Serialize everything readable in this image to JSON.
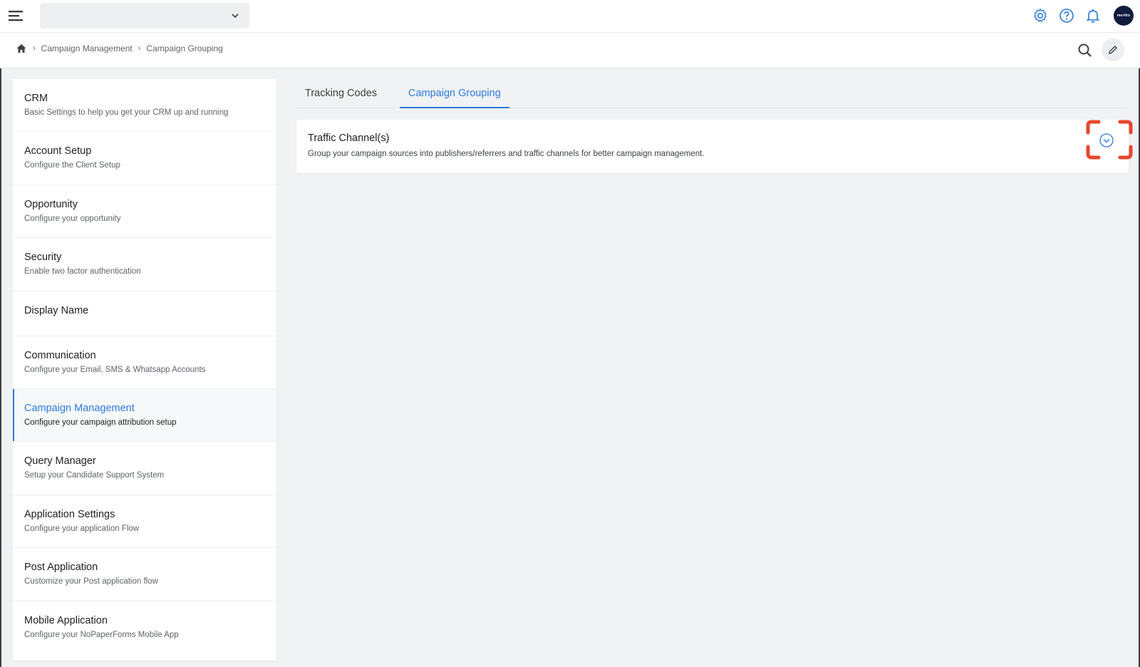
{
  "header": {
    "client_select_value": "",
    "icons": [
      "menu-icon",
      "chevron-down-icon",
      "gear-icon",
      "help-icon",
      "bell-icon"
    ],
    "avatar_text": "meritto",
    "accent_color": "#2e7bdc"
  },
  "breadcrumb": {
    "items": [
      "Campaign Management",
      "Campaign Grouping"
    ]
  },
  "sidebar": {
    "items": [
      {
        "title": "CRM",
        "desc": "Basic Settings to help you get your CRM up and running"
      },
      {
        "title": "Account Setup",
        "desc": "Configure the Client Setup"
      },
      {
        "title": "Opportunity",
        "desc": "Configure your opportunity"
      },
      {
        "title": "Security",
        "desc": "Enable two factor authentication"
      },
      {
        "title": "Display Name",
        "desc": ""
      },
      {
        "title": "Communication",
        "desc": "Configure your Email, SMS & Whatsapp Accounts"
      },
      {
        "title": "Campaign Management",
        "desc": "Configure your campaign attribution setup"
      },
      {
        "title": "Query Manager",
        "desc": "Setup your Candidate Support System"
      },
      {
        "title": "Application Settings",
        "desc": "Configure your application Flow"
      },
      {
        "title": "Post Application",
        "desc": "Customize your Post application flow"
      },
      {
        "title": "Mobile Application",
        "desc": "Configure your NoPaperForms Mobile App"
      }
    ],
    "active_index": 6
  },
  "tabs": [
    {
      "label": "Tracking Codes"
    },
    {
      "label": "Campaign Grouping"
    }
  ],
  "active_tab": 1,
  "card": {
    "title": "Traffic Channel(s)",
    "description": "Group your campaign sources into publishers/referrers and traffic channels for better campaign management."
  },
  "highlight_color": "#e8452c"
}
